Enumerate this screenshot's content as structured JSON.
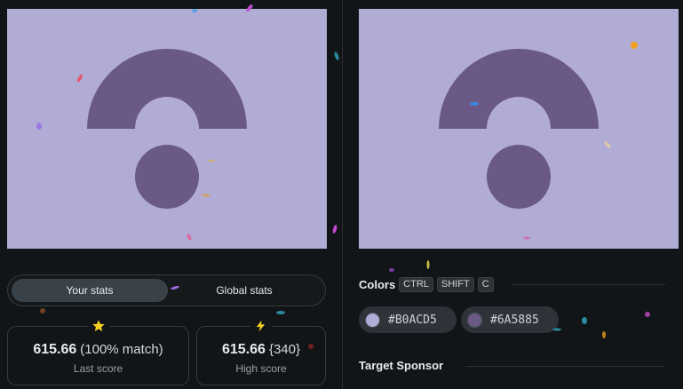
{
  "colors": {
    "background": "#B0ACD5",
    "shape": "#6A5885"
  },
  "stats_tabs": {
    "your_stats": "Your stats",
    "global_stats": "Global stats"
  },
  "stats": {
    "last_score_value": "615.66",
    "last_score_match": "(100% match)",
    "last_score_label": "Last score",
    "high_score_value": "615.66",
    "high_score_count": "{340}",
    "high_score_label": "High score",
    "last_icon": "star-icon",
    "high_icon": "lightning-icon"
  },
  "colors_section": {
    "title": "Colors",
    "shortcut": [
      "CTRL",
      "SHIFT",
      "C"
    ],
    "swatch_1": "#B0ACD5",
    "swatch_2": "#6A5885"
  },
  "sponsor_section": {
    "title": "Target Sponsor"
  }
}
